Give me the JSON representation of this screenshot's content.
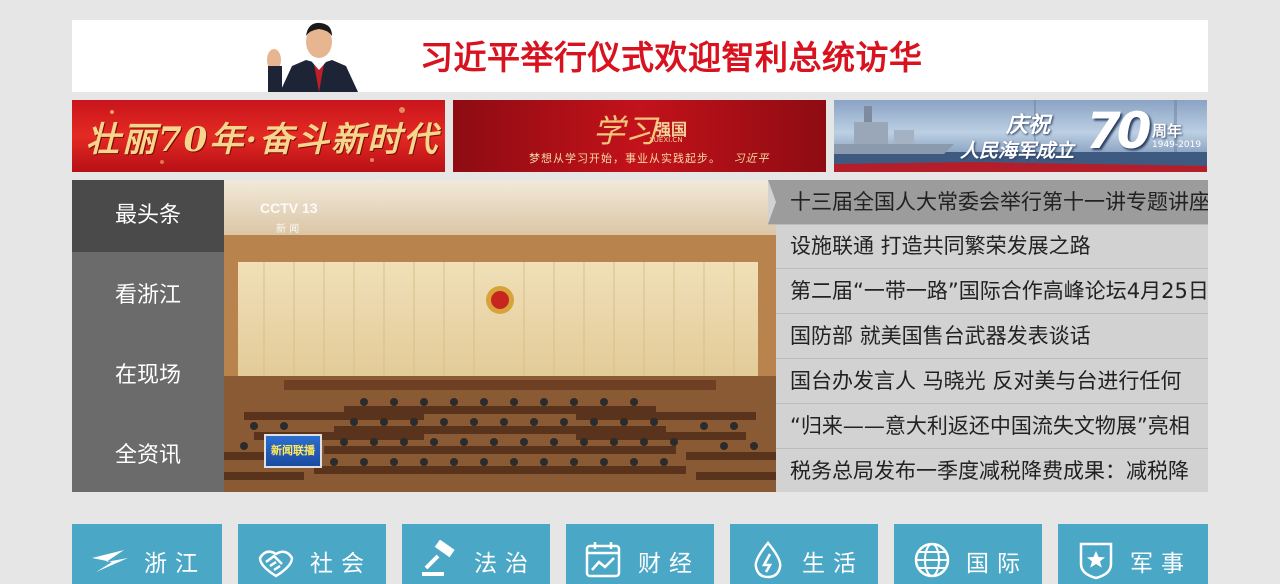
{
  "top_banner": {
    "headline": "习近平举行仪式欢迎智利总统访华"
  },
  "promos": {
    "promo1_text": "壮丽70年·奋斗新时代",
    "promo2_title": "学习",
    "promo2_brand": "强国",
    "promo2_domain": "XUEXI.CN",
    "promo2_slogan": "梦想从学习开始，事业从实践起步。",
    "promo2_sign": "习近平",
    "promo3_line1": "庆祝",
    "promo3_line2": "人民海军成立",
    "promo3_big": "70",
    "promo3_suffix": "周年",
    "promo3_years": "1949-2019"
  },
  "category_menu": {
    "items": [
      {
        "label": "最头条"
      },
      {
        "label": "看浙江"
      },
      {
        "label": "在现场"
      },
      {
        "label": "全资讯"
      }
    ]
  },
  "video": {
    "channel": "CCTV 13",
    "channel_sub": "新 闻",
    "bug": "新闻联播"
  },
  "headlines": [
    {
      "text": "十三届全国人大常委会举行第十一讲专题讲座"
    },
    {
      "text": "设施联通 打造共同繁荣发展之路"
    },
    {
      "text": "第二届“一带一路”国际合作高峰论坛4月25日"
    },
    {
      "text": "国防部 就美国售台武器发表谈话"
    },
    {
      "text": "国台办发言人 马晓光 反对美与台进行任何"
    },
    {
      "text": "“归来——意大利返还中国流失文物展”亮相"
    },
    {
      "text": "税务总局发布一季度减税降费成果：减税降"
    }
  ],
  "tiles": [
    {
      "label": "浙江",
      "icon": "zhejiang-logo-icon"
    },
    {
      "label": "社会",
      "icon": "handshake-icon"
    },
    {
      "label": "法治",
      "icon": "gavel-icon"
    },
    {
      "label": "财经",
      "icon": "chart-calendar-icon"
    },
    {
      "label": "生活",
      "icon": "water-drop-icon"
    },
    {
      "label": "国际",
      "icon": "globe-icon"
    },
    {
      "label": "军事",
      "icon": "star-shield-icon"
    }
  ],
  "colors": {
    "headline_red": "#d8121e",
    "tile_blue": "#4ba7c6",
    "menu_grey": "#6b6b6b",
    "menu_active": "#4a4a4a"
  }
}
